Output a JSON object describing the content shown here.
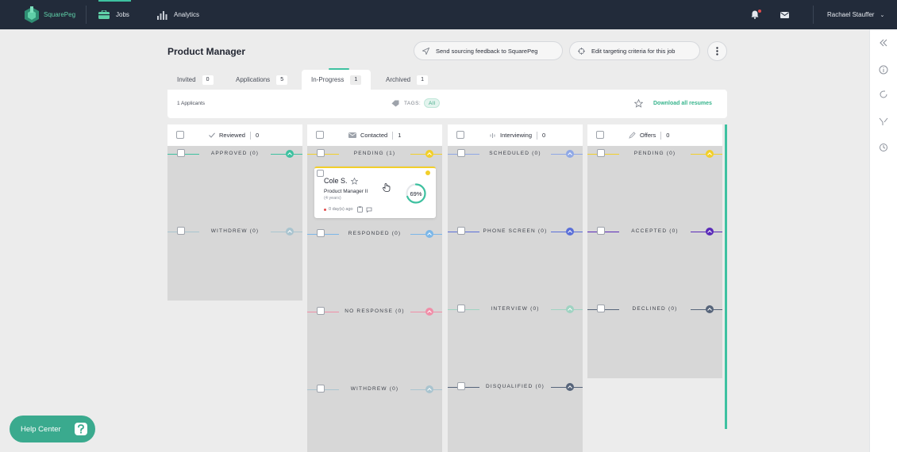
{
  "nav": {
    "logo_text": "SquarePeg",
    "jobs_label": "Jobs",
    "analytics_label": "Analytics",
    "user_name": "Rachael Stauffer"
  },
  "header": {
    "title": "Product Manager",
    "feedback_label": "Send sourcing feedback to SquarePeg",
    "targeting_label": "Edit targeting criteria for this job"
  },
  "tabs": [
    {
      "label": "Invited",
      "count": "0"
    },
    {
      "label": "Applications",
      "count": "5"
    },
    {
      "label": "In-Progress",
      "count": "1",
      "active": true
    },
    {
      "label": "Archived",
      "count": "1"
    }
  ],
  "filterbar": {
    "applicants": "1 Applicants",
    "tags_label": "TAGS:",
    "tags_chip": "All",
    "download_label": "Download all resumes"
  },
  "columns": [
    {
      "title": "Reviewed",
      "count": "0",
      "icon": "check-icon",
      "stages": [
        {
          "label": "APPROVED (0)",
          "color": "#3ec1a0"
        },
        {
          "label": "WITHDREW (0)",
          "color": "#a9c4cf"
        }
      ]
    },
    {
      "title": "Contacted",
      "count": "1",
      "icon": "mail-icon",
      "stages": [
        {
          "label": "PENDING (1)",
          "color": "#f2cf2a"
        },
        {
          "label": "RESPONDED (0)",
          "color": "#7cb7e8"
        },
        {
          "label": "NO RESPONSE (0)",
          "color": "#f08ea8"
        },
        {
          "label": "WITHDREW (0)",
          "color": "#a9c4cf"
        }
      ]
    },
    {
      "title": "Interviewing",
      "count": "0",
      "icon": "sound-icon",
      "stages": [
        {
          "label": "SCHEDULED (0)",
          "color": "#8fa8e6"
        },
        {
          "label": "PHONE SCREEN (0)",
          "color": "#5a6fd8"
        },
        {
          "label": "INTERVIEW (0)",
          "color": "#9fd3c2"
        },
        {
          "label": "DISQUALIFIED (0)",
          "color": "#56647a"
        }
      ]
    },
    {
      "title": "Offers",
      "count": "0",
      "icon": "pen-icon",
      "stages": [
        {
          "label": "PENDING (0)",
          "color": "#f2cf2a"
        },
        {
          "label": "ACCEPTED (0)",
          "color": "#5a2bb8"
        },
        {
          "label": "DECLINED (0)",
          "color": "#56647a"
        }
      ]
    }
  ],
  "candidate": {
    "name": "Cole S.",
    "role": "Product Manager II",
    "years": "(4 years)",
    "age": "0 day(s) ago",
    "score": "69%",
    "score_fraction": 0.69
  },
  "help": {
    "label": "Help Center"
  }
}
